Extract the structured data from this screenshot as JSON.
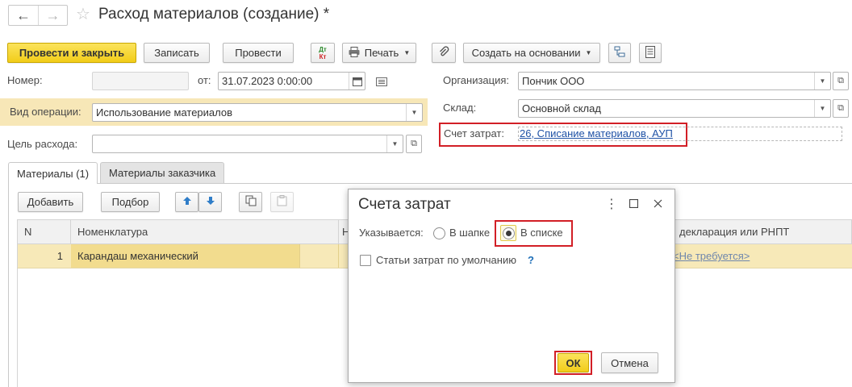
{
  "window": {
    "title": "Расход материалов (создание) *",
    "back_glyph": "←",
    "forward_glyph": "→",
    "favorite_glyph": "☆"
  },
  "toolbar": {
    "post_close": "Провести и закрыть",
    "save": "Записать",
    "post": "Провести",
    "dtkt_top": "Дт",
    "dtkt_bottom": "Кт",
    "print": "Печать",
    "create_based": "Создать на основании"
  },
  "form": {
    "number_label": "Номер:",
    "number_value": "",
    "date_label": "от:",
    "date_value": "31.07.2023  0:00:00",
    "org_label": "Организация:",
    "org_value": "Пончик ООО",
    "warehouse_label": "Склад:",
    "warehouse_value": "Основной склад",
    "operation_label": "Вид операции:",
    "operation_value": "Использование материалов",
    "purpose_label": "Цель расхода:",
    "purpose_value": "",
    "cost_account_label": "Счет затрат:",
    "cost_account_value": "26, Списание материалов, АУП"
  },
  "tabs": [
    {
      "label": "Материалы (1)",
      "active": true
    },
    {
      "label": "Материалы заказчика",
      "active": false
    }
  ],
  "table_toolbar": {
    "add": "Добавить",
    "pick": "Подбор"
  },
  "table": {
    "columns": [
      "N",
      "Номенклатура",
      "Н",
      "декларация или РНПТ"
    ],
    "rows": [
      {
        "n": "1",
        "item": "Карандаш механический",
        "declaration": "<Не требуется>"
      }
    ]
  },
  "dialog": {
    "title": "Счета затрат",
    "specified_label": "Указывается:",
    "option_header": "В шапке",
    "option_list": "В списке",
    "selected": "list",
    "checkbox_label": "Статьи затрат по умолчанию",
    "help": "?",
    "ok": "ОК",
    "cancel": "Отмена"
  },
  "colors": {
    "primary_button": "#f2cd19",
    "selection_row": "#f7e9b8",
    "highlight_red": "#d21f26",
    "link": "#1f52a6"
  }
}
